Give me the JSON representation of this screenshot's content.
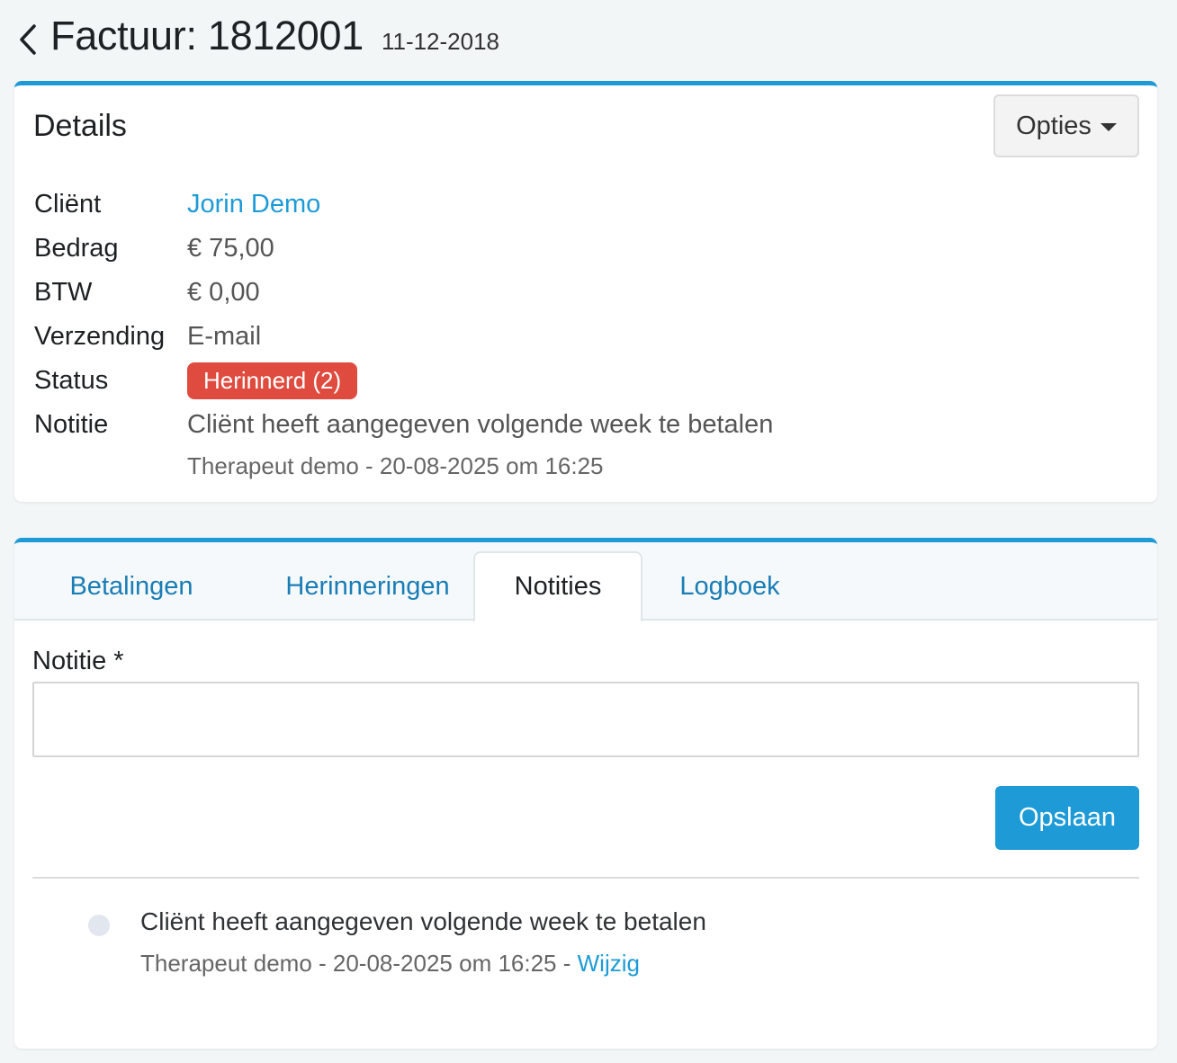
{
  "header": {
    "title": "Factuur: 1812001",
    "date": "11-12-2018"
  },
  "details": {
    "title": "Details",
    "options_label": "Opties",
    "rows": [
      {
        "label": "Cliënt",
        "value": "Jorin Demo"
      },
      {
        "label": "Bedrag",
        "value": "€ 75,00"
      },
      {
        "label": "BTW",
        "value": "€ 0,00"
      },
      {
        "label": "Verzending",
        "value": "E-mail"
      },
      {
        "label": "Status",
        "value": "Herinnerd (2)"
      },
      {
        "label": "Notitie",
        "value": "Cliënt heeft aangegeven volgende week te betalen"
      }
    ],
    "note_meta": "Therapeut demo - 20-08-2025 om 16:25"
  },
  "tabs": [
    {
      "label": "Betalingen"
    },
    {
      "label": "Herinneringen"
    },
    {
      "label": "Notities"
    },
    {
      "label": "Logboek"
    }
  ],
  "form": {
    "label": "Notitie *",
    "value": "",
    "save_label": "Opslaan"
  },
  "notes": [
    {
      "text": "Cliënt heeft aangegeven volgende week te betalen",
      "meta": "Therapeut demo - 20-08-2025 om 16:25 - ",
      "edit_label": "Wijzig"
    }
  ],
  "colors": {
    "accent": "#1e9bd7",
    "status_badge": "#e04b3f"
  },
  "icons": {
    "back": "chevron-left-icon",
    "dropdown": "caret-down-icon"
  }
}
